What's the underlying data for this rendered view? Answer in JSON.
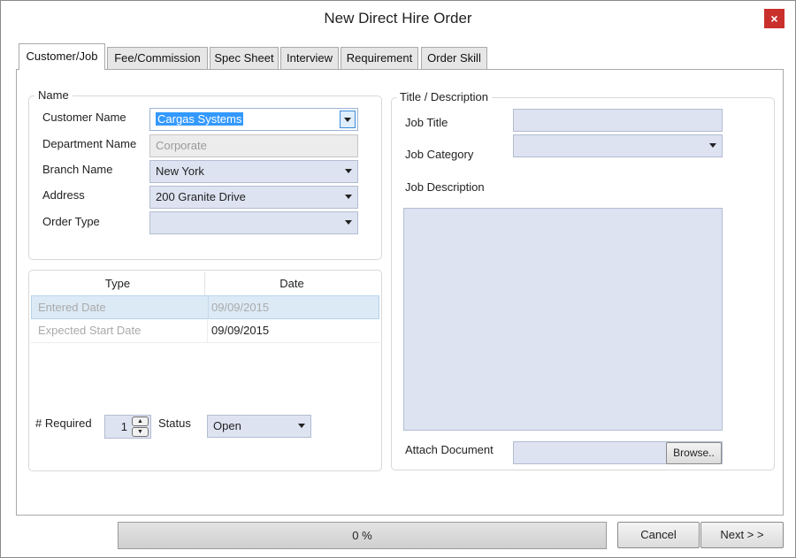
{
  "window": {
    "title": "New Direct Hire Order",
    "close_glyph": "×"
  },
  "tabs": [
    {
      "label": "Customer/Job",
      "active": true
    },
    {
      "label": "Fee/Commission",
      "active": false
    },
    {
      "label": "Spec Sheet",
      "active": false
    },
    {
      "label": "Interview",
      "active": false
    },
    {
      "label": "Requirement",
      "active": false
    },
    {
      "label": "Order Skill",
      "active": false
    }
  ],
  "name_group": {
    "legend": "Name",
    "customer_name": {
      "label": "Customer Name",
      "value": "Cargas Systems"
    },
    "department_name": {
      "label": "Department Name",
      "value": "Corporate"
    },
    "branch_name": {
      "label": "Branch Name",
      "value": "New York"
    },
    "address": {
      "label": "Address",
      "value": "200 Granite Drive"
    },
    "order_type": {
      "label": "Order Type",
      "value": ""
    }
  },
  "dates_grid": {
    "columns": [
      "Type",
      "Date"
    ],
    "rows": [
      {
        "type": "Entered Date",
        "date": "09/09/2015",
        "selected": true
      },
      {
        "type": "Expected Start Date",
        "date": "09/09/2015",
        "selected": false
      }
    ]
  },
  "required": {
    "label": "# Required",
    "value": "1"
  },
  "status": {
    "label": "Status",
    "value": "Open"
  },
  "title_group": {
    "legend": "Title / Description",
    "job_title": {
      "label": "Job Title",
      "value": ""
    },
    "job_category": {
      "label": "Job Category",
      "value": ""
    },
    "job_description": {
      "label": "Job Description",
      "value": ""
    },
    "attach_document": {
      "label": "Attach Document",
      "value": "",
      "browse_label": "Browse.."
    }
  },
  "footer": {
    "progress_percent": 0,
    "progress_text": "0 %",
    "cancel_label": "Cancel",
    "next_label": "Next > >"
  },
  "colors": {
    "field_bg": "#dde3f1",
    "selection": "#3399ff",
    "close_red": "#c9302c",
    "grid_selected": "#dceaf6"
  },
  "icons": [
    "close-icon",
    "chevron-down-icon",
    "spin-up-icon",
    "spin-down-icon"
  ]
}
